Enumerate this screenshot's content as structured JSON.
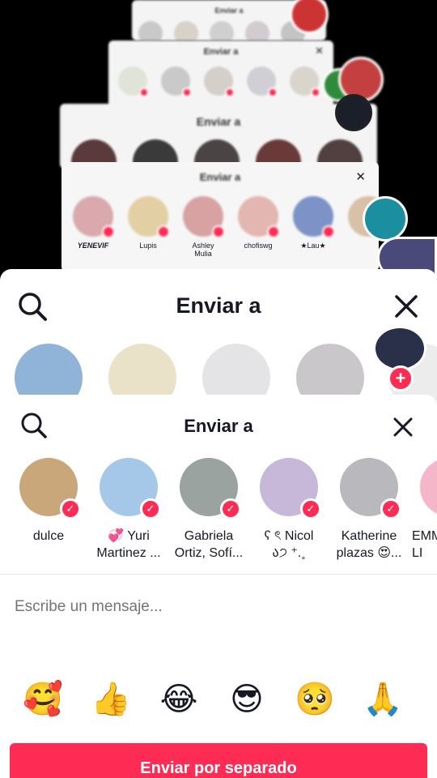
{
  "background_sheets": [
    {
      "title": "Enviar a",
      "names": []
    },
    {
      "title": "Enviar a",
      "names": []
    },
    {
      "title": "Enviar a",
      "names": []
    },
    {
      "title": "Enviar a",
      "names": [
        "YENEVIF",
        "Lupis",
        "Ashley\nMulia",
        "chofiswg",
        "★Lau★"
      ]
    }
  ],
  "middle_sheet": {
    "title": "Enviar a"
  },
  "front_sheet": {
    "title": "Enviar a",
    "contacts": [
      {
        "name": "dulce",
        "color": "#c9a77a"
      },
      {
        "name": "💞 Yuri\nMartinez ...",
        "color": "#a6c8e8"
      },
      {
        "name": "Gabriela\nOrtiz, Sofí...",
        "color": "#9aa3a0"
      },
      {
        "name": "ʕ ৎ Nicol\nა੭ ⁺.˳",
        "color": "#c7b7d8"
      },
      {
        "name": "Katherine\nplazas 😍...",
        "color": "#b9b9bd"
      },
      {
        "name": "EMM\nLI",
        "color": "#f4b6c8"
      }
    ],
    "message_placeholder": "Escribe un mensaje...",
    "emojis": [
      "🥰",
      "👍",
      "😂",
      "😎",
      "🥺",
      "🙏"
    ],
    "send_button_label": "Enviar por separado"
  },
  "colors": {
    "accent": "#fe2c55",
    "sheet_bg": "#ffffff",
    "backdrop": "#000000"
  }
}
